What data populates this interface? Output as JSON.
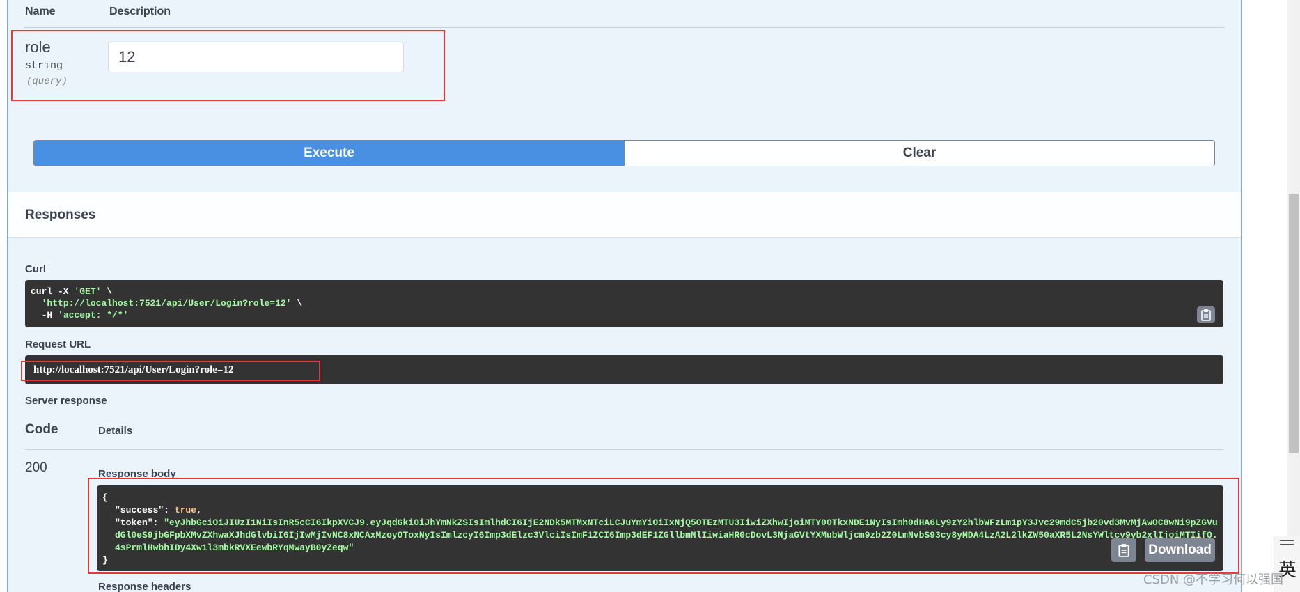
{
  "params": {
    "header_name": "Name",
    "header_description": "Description",
    "role": {
      "name": "role",
      "type": "string",
      "location": "(query)",
      "value": "12"
    }
  },
  "actions": {
    "execute_label": "Execute",
    "clear_label": "Clear"
  },
  "responses": {
    "title": "Responses",
    "curl_label": "Curl",
    "curl_line1_cmd": "curl -X ",
    "curl_line1_method": "'GET'",
    "curl_line1_cont": " \\",
    "curl_line2_url": "'http://localhost:7521/api/User/Login?role=12'",
    "curl_line2_cont": " \\",
    "curl_line3_flag": "  -H ",
    "curl_line3_header": "'accept: */*'",
    "request_url_label": "Request URL",
    "request_url": "http://localhost:7521/api/User/Login?role=12",
    "server_response_label": "Server response",
    "code_header": "Code",
    "details_header": "Details",
    "status_code": "200",
    "response_body_label": "Response body",
    "body_open": "{",
    "body_success_key": "\"success\"",
    "body_success_value": "true",
    "body_token_key": "\"token\"",
    "body_token_value": "\"eyJhbGciOiJIUzI1NiIsInR5cCI6IkpXVCJ9.eyJqdGkiOiJhYmNkZSIsImlhdCI6IjE2NDk5MTMxNTciLCJuYmYiOiIxNjQ5OTEzMTU3IiwiZXhwIjoiMTY0OTkxNDE1NyIsImh0dHA6Ly9zY2hlbWFzLm1pY3Jvc29mdC5jb20vd3MvMjAwOC8wNi9pZGVudGl0eS9jbGFpbXMvZXhwaXJhdGlvbiI6IjIwMjIvNC8xNCAxMzoyOToxNyIsImlzcyI6Imp3dElzc3VlciIsImF1ZCI6Imp3dEF1ZGllbmNlIiwiaHR0cDovL3NjaGVtYXMubWljcm9zb2Z0LmNvbS93cy8yMDA4LzA2L2lkZW50aXR5L2NsYWltcy9yb2xlIjoiMTIifQ.4sPrmlHwbhIDy4Xw1l3mbkRVXEewbRYqMwayB0yZeqw\"",
    "body_close": "}",
    "download_label": "Download",
    "response_headers_label": "Response headers"
  },
  "icons": {
    "copy": "clipboard-icon"
  },
  "overlay": {
    "ime_char": "英",
    "watermark": "CSDN @不学习何以强国"
  },
  "colors": {
    "execute_bg": "#4990e2",
    "highlight_border": "#e53935",
    "code_bg": "#333333",
    "string_green": "#a2fca2"
  }
}
